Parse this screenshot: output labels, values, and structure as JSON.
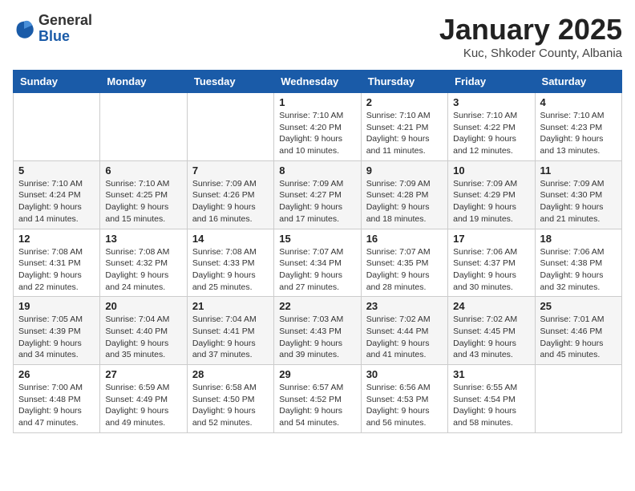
{
  "header": {
    "logo_general": "General",
    "logo_blue": "Blue",
    "month_title": "January 2025",
    "location": "Kuc, Shkoder County, Albania"
  },
  "weekdays": [
    "Sunday",
    "Monday",
    "Tuesday",
    "Wednesday",
    "Thursday",
    "Friday",
    "Saturday"
  ],
  "weeks": [
    [
      {
        "day": "",
        "info": ""
      },
      {
        "day": "",
        "info": ""
      },
      {
        "day": "",
        "info": ""
      },
      {
        "day": "1",
        "info": "Sunrise: 7:10 AM\nSunset: 4:20 PM\nDaylight: 9 hours\nand 10 minutes."
      },
      {
        "day": "2",
        "info": "Sunrise: 7:10 AM\nSunset: 4:21 PM\nDaylight: 9 hours\nand 11 minutes."
      },
      {
        "day": "3",
        "info": "Sunrise: 7:10 AM\nSunset: 4:22 PM\nDaylight: 9 hours\nand 12 minutes."
      },
      {
        "day": "4",
        "info": "Sunrise: 7:10 AM\nSunset: 4:23 PM\nDaylight: 9 hours\nand 13 minutes."
      }
    ],
    [
      {
        "day": "5",
        "info": "Sunrise: 7:10 AM\nSunset: 4:24 PM\nDaylight: 9 hours\nand 14 minutes."
      },
      {
        "day": "6",
        "info": "Sunrise: 7:10 AM\nSunset: 4:25 PM\nDaylight: 9 hours\nand 15 minutes."
      },
      {
        "day": "7",
        "info": "Sunrise: 7:09 AM\nSunset: 4:26 PM\nDaylight: 9 hours\nand 16 minutes."
      },
      {
        "day": "8",
        "info": "Sunrise: 7:09 AM\nSunset: 4:27 PM\nDaylight: 9 hours\nand 17 minutes."
      },
      {
        "day": "9",
        "info": "Sunrise: 7:09 AM\nSunset: 4:28 PM\nDaylight: 9 hours\nand 18 minutes."
      },
      {
        "day": "10",
        "info": "Sunrise: 7:09 AM\nSunset: 4:29 PM\nDaylight: 9 hours\nand 19 minutes."
      },
      {
        "day": "11",
        "info": "Sunrise: 7:09 AM\nSunset: 4:30 PM\nDaylight: 9 hours\nand 21 minutes."
      }
    ],
    [
      {
        "day": "12",
        "info": "Sunrise: 7:08 AM\nSunset: 4:31 PM\nDaylight: 9 hours\nand 22 minutes."
      },
      {
        "day": "13",
        "info": "Sunrise: 7:08 AM\nSunset: 4:32 PM\nDaylight: 9 hours\nand 24 minutes."
      },
      {
        "day": "14",
        "info": "Sunrise: 7:08 AM\nSunset: 4:33 PM\nDaylight: 9 hours\nand 25 minutes."
      },
      {
        "day": "15",
        "info": "Sunrise: 7:07 AM\nSunset: 4:34 PM\nDaylight: 9 hours\nand 27 minutes."
      },
      {
        "day": "16",
        "info": "Sunrise: 7:07 AM\nSunset: 4:35 PM\nDaylight: 9 hours\nand 28 minutes."
      },
      {
        "day": "17",
        "info": "Sunrise: 7:06 AM\nSunset: 4:37 PM\nDaylight: 9 hours\nand 30 minutes."
      },
      {
        "day": "18",
        "info": "Sunrise: 7:06 AM\nSunset: 4:38 PM\nDaylight: 9 hours\nand 32 minutes."
      }
    ],
    [
      {
        "day": "19",
        "info": "Sunrise: 7:05 AM\nSunset: 4:39 PM\nDaylight: 9 hours\nand 34 minutes."
      },
      {
        "day": "20",
        "info": "Sunrise: 7:04 AM\nSunset: 4:40 PM\nDaylight: 9 hours\nand 35 minutes."
      },
      {
        "day": "21",
        "info": "Sunrise: 7:04 AM\nSunset: 4:41 PM\nDaylight: 9 hours\nand 37 minutes."
      },
      {
        "day": "22",
        "info": "Sunrise: 7:03 AM\nSunset: 4:43 PM\nDaylight: 9 hours\nand 39 minutes."
      },
      {
        "day": "23",
        "info": "Sunrise: 7:02 AM\nSunset: 4:44 PM\nDaylight: 9 hours\nand 41 minutes."
      },
      {
        "day": "24",
        "info": "Sunrise: 7:02 AM\nSunset: 4:45 PM\nDaylight: 9 hours\nand 43 minutes."
      },
      {
        "day": "25",
        "info": "Sunrise: 7:01 AM\nSunset: 4:46 PM\nDaylight: 9 hours\nand 45 minutes."
      }
    ],
    [
      {
        "day": "26",
        "info": "Sunrise: 7:00 AM\nSunset: 4:48 PM\nDaylight: 9 hours\nand 47 minutes."
      },
      {
        "day": "27",
        "info": "Sunrise: 6:59 AM\nSunset: 4:49 PM\nDaylight: 9 hours\nand 49 minutes."
      },
      {
        "day": "28",
        "info": "Sunrise: 6:58 AM\nSunset: 4:50 PM\nDaylight: 9 hours\nand 52 minutes."
      },
      {
        "day": "29",
        "info": "Sunrise: 6:57 AM\nSunset: 4:52 PM\nDaylight: 9 hours\nand 54 minutes."
      },
      {
        "day": "30",
        "info": "Sunrise: 6:56 AM\nSunset: 4:53 PM\nDaylight: 9 hours\nand 56 minutes."
      },
      {
        "day": "31",
        "info": "Sunrise: 6:55 AM\nSunset: 4:54 PM\nDaylight: 9 hours\nand 58 minutes."
      },
      {
        "day": "",
        "info": ""
      }
    ]
  ]
}
